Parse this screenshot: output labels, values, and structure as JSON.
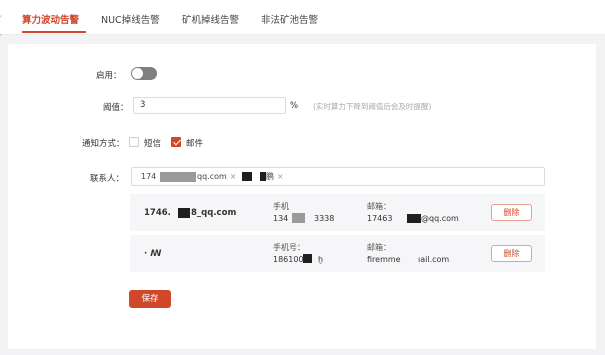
{
  "tabs": [
    {
      "label": "算力波动告警",
      "active": true
    },
    {
      "label": "NUC掉线告警",
      "active": false
    },
    {
      "label": "矿机掉线告警",
      "active": false
    },
    {
      "label": "非法矿池告警",
      "active": false
    }
  ],
  "form": {
    "enable_label": "启用：",
    "enabled": false,
    "threshold_label": "阈值：",
    "threshold_value": "3",
    "threshold_unit": "%",
    "threshold_hint": "(实时算力下降到阈值后会及时提醒)",
    "notify_label": "通知方式：",
    "notify_sms_label": "短信",
    "notify_sms_checked": false,
    "notify_email_label": "邮件",
    "notify_email_checked": true,
    "contacts_label": "联系人：",
    "contact_tags": [
      {
        "text": "174",
        "suffix": "qq.com",
        "remove": "×"
      },
      {
        "text": "",
        "suffix": "鹏",
        "remove": "×"
      }
    ]
  },
  "contacts_table": {
    "rows": [
      {
        "name": "1746.",
        "name_suffix": "8_qq.com",
        "phone_label": "手机",
        "phone_value_a": "134",
        "phone_value_b": "3338",
        "email_label": "邮箱：",
        "email_value_a": "17463",
        "email_value_b": "@qq.com",
        "delete_label": "删除"
      },
      {
        "name": "·  ꟿ",
        "name_suffix": "",
        "phone_label": "手机号：",
        "phone_value_a": "186100.",
        "phone_value_b": "ḫ",
        "email_label": "邮箱：",
        "email_value_a": "firemme",
        "email_value_b": "ıail.com",
        "delete_label": "删除"
      }
    ]
  },
  "save_label": "保存",
  "colors": {
    "accent": "#d0482c",
    "background": "#f3f3f5",
    "row_bg": "#f6f6f8"
  }
}
